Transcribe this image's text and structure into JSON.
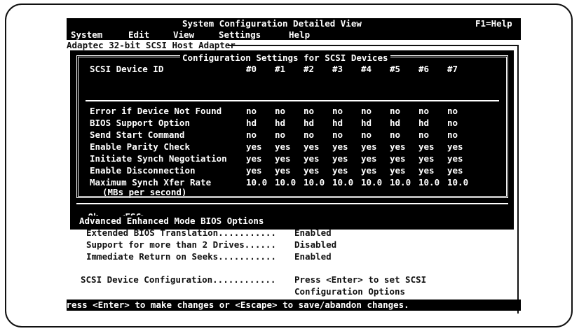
{
  "window": {
    "title": "System Configuration Detailed View",
    "help_hint": "F1=Help",
    "menu": [
      "System",
      "Edit",
      "View",
      "Settings",
      "Help"
    ]
  },
  "host_adapter_title": "Adaptec 32-bit SCSI Host Adapter",
  "dialog": {
    "title": "Configuration Settings for SCSI Devices",
    "device_id_label": "SCSI Device ID",
    "device_ids": [
      "#0",
      "#1",
      "#2",
      "#3",
      "#4",
      "#5",
      "#6",
      "#7"
    ],
    "rows": [
      {
        "label": "Error if Device Not Found",
        "values": [
          "no",
          "no",
          "no",
          "no",
          "no",
          "no",
          "no",
          "no"
        ]
      },
      {
        "label": "BIOS Support Option",
        "values": [
          "hd",
          "hd",
          "hd",
          "hd",
          "hd",
          "hd",
          "hd",
          "no"
        ]
      },
      {
        "label": "Send Start Command",
        "values": [
          "no",
          "no",
          "no",
          "no",
          "no",
          "no",
          "no",
          "no"
        ]
      },
      {
        "label": "Enable Parity Check",
        "values": [
          "yes",
          "yes",
          "yes",
          "yes",
          "yes",
          "yes",
          "yes",
          "yes"
        ]
      },
      {
        "label": "Initiate Synch Negotiation",
        "values": [
          "yes",
          "yes",
          "yes",
          "yes",
          "yes",
          "yes",
          "yes",
          "yes"
        ]
      },
      {
        "label": "Enable Disconnection",
        "values": [
          "yes",
          "yes",
          "yes",
          "yes",
          "yes",
          "yes",
          "yes",
          "yes"
        ]
      },
      {
        "label": "Maximum Synch Xfer Rate",
        "values": [
          "10.0",
          "10.0",
          "10.0",
          "10.0",
          "10.0",
          "10.0",
          "10.0",
          "10.0"
        ]
      }
    ],
    "rate_unit": "(MBs per second)",
    "ok_button": "►Ok◄",
    "esc_button": "<ESC>"
  },
  "bios_options": {
    "title": "Advanced Enhanced Mode BIOS Options",
    "items": [
      {
        "label": "Extended BIOS Translation...........",
        "value": "Enabled"
      },
      {
        "label": "Support for more than 2 Drives......",
        "value": "Disabled"
      },
      {
        "label": "Immediate Return on Seeks...........",
        "value": "Enabled"
      }
    ]
  },
  "device_config": {
    "label": "SCSI Device Configuration............",
    "value_line1": "Press <Enter> to set SCSI",
    "value_line2": "Configuration Options"
  },
  "status_bar": "Press <Enter> to make changes or <Escape> to save/abandon changes."
}
